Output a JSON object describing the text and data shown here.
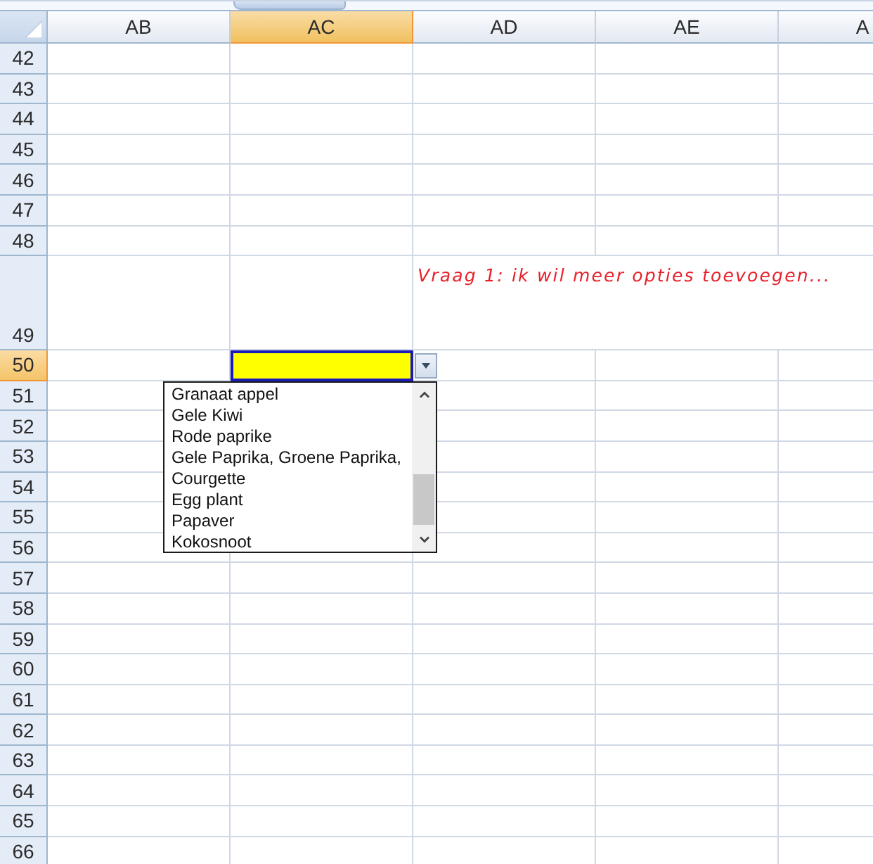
{
  "sheet": {
    "columns": [
      {
        "label": "AB",
        "selected": false
      },
      {
        "label": "AC",
        "selected": true
      },
      {
        "label": "AD",
        "selected": false
      },
      {
        "label": "AE",
        "selected": false
      },
      {
        "label": "A",
        "selected": false
      }
    ],
    "rows": [
      {
        "label": "42",
        "selected": false
      },
      {
        "label": "43",
        "selected": false
      },
      {
        "label": "44",
        "selected": false
      },
      {
        "label": "45",
        "selected": false
      },
      {
        "label": "46",
        "selected": false
      },
      {
        "label": "47",
        "selected": false
      },
      {
        "label": "48",
        "selected": false
      },
      {
        "label": "49",
        "selected": false,
        "note": "Vraag 1: ik wil meer opties toevoegen..."
      },
      {
        "label": "50",
        "selected": true
      },
      {
        "label": "51",
        "selected": false
      },
      {
        "label": "52",
        "selected": false
      },
      {
        "label": "53",
        "selected": false
      },
      {
        "label": "54",
        "selected": false
      },
      {
        "label": "55",
        "selected": false
      },
      {
        "label": "56",
        "selected": false
      },
      {
        "label": "57",
        "selected": false
      },
      {
        "label": "58",
        "selected": false
      },
      {
        "label": "59",
        "selected": false
      },
      {
        "label": "60",
        "selected": false
      },
      {
        "label": "61",
        "selected": false
      },
      {
        "label": "62",
        "selected": false
      },
      {
        "label": "63",
        "selected": false
      },
      {
        "label": "64",
        "selected": false
      },
      {
        "label": "65",
        "selected": false
      },
      {
        "label": "66",
        "selected": false
      }
    ]
  },
  "dropdown": {
    "expanded": true,
    "items": [
      {
        "label": "Granaat appel",
        "selected": false
      },
      {
        "label": "Gele Kiwi",
        "selected": false
      },
      {
        "label": "Rode paprike",
        "selected": false
      },
      {
        "label": "Gele Paprika, Groene Paprika,",
        "selected": false
      },
      {
        "label": "Courgette",
        "selected": false
      },
      {
        "label": "Egg plant",
        "selected": false
      },
      {
        "label": "Papaver",
        "selected": false
      },
      {
        "label": "Kokosnoot",
        "selected": false
      }
    ]
  }
}
